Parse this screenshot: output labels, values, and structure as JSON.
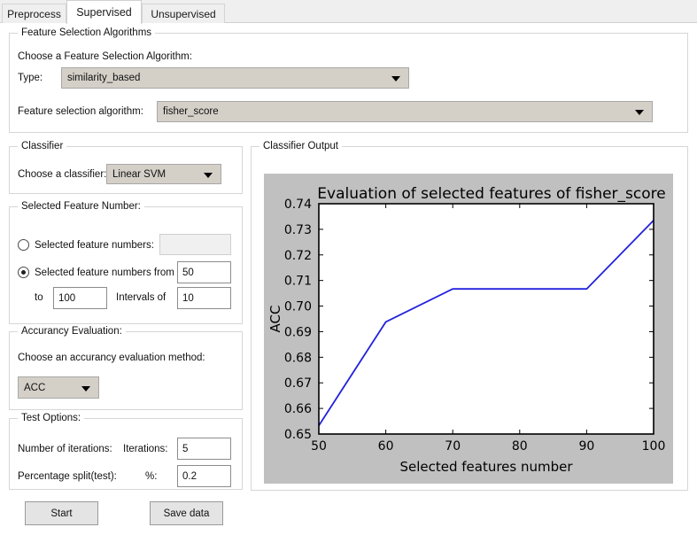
{
  "tabs": [
    {
      "label": "Preprocess",
      "active": false
    },
    {
      "label": "Supervised",
      "active": true
    },
    {
      "label": "Unsupervised",
      "active": false
    }
  ],
  "feature_selection": {
    "group_label": "Feature Selection Algorithms",
    "prompt": "Choose a Feature Selection Algorithm:",
    "type_label": "Type:",
    "type_value": "similarity_based",
    "algorithm_label": "Feature selection algorithm:",
    "algorithm_value": "fisher_score"
  },
  "classifier": {
    "group_label": "Classifier",
    "choose_label": "Choose a classifier:",
    "value": "Linear SVM"
  },
  "selected_feature_number": {
    "group_label": "Selected Feature Number:",
    "single_radio_label": "Selected feature numbers:",
    "single_value": "",
    "single_selected": false,
    "range_radio_label": "Selected feature numbers from",
    "range_selected": true,
    "from_value": "50",
    "to_label": "to",
    "to_value": "100",
    "intervals_label": "Intervals of",
    "intervals_value": "10"
  },
  "accuracy_evaluation": {
    "group_label": "Accurancy Evaluation:",
    "prompt": "Choose an accurancy evaluation method:",
    "value": "ACC"
  },
  "test_options": {
    "group_label": "Test Options:",
    "iterations_row_label": "Number of iterations:",
    "iterations_field_label": "Iterations:",
    "iterations_value": "5",
    "split_row_label": "Percentage split(test):",
    "split_field_label": "%:",
    "split_value": "0.2"
  },
  "actions": {
    "start_label": "Start",
    "save_label": "Save data"
  },
  "classifier_output": {
    "group_label": "Classifier Output"
  },
  "chart_data": {
    "type": "line",
    "title": "Evaluation of selected features of fisher_score",
    "xlabel": "Selected features number",
    "ylabel": "ACC",
    "x": [
      50,
      60,
      70,
      80,
      90,
      100
    ],
    "values": [
      0.6533,
      0.6938,
      0.7067,
      0.7067,
      0.7067,
      0.7335
    ],
    "series": [
      {
        "name": "ACC",
        "color": "#2222dd",
        "values": [
          0.6533,
          0.6938,
          0.7067,
          0.7067,
          0.7067,
          0.7335
        ]
      }
    ],
    "xlim": [
      50,
      100
    ],
    "ylim": [
      0.65,
      0.74
    ],
    "xticks": [
      50,
      60,
      70,
      80,
      90,
      100
    ],
    "yticks": [
      0.65,
      0.66,
      0.67,
      0.68,
      0.69,
      0.7,
      0.71,
      0.72,
      0.73,
      0.74
    ],
    "xticklabels": [
      "50",
      "60",
      "70",
      "80",
      "90",
      "100"
    ],
    "yticklabels": [
      "0.65",
      "0.66",
      "0.67",
      "0.68",
      "0.69",
      "0.70",
      "0.71",
      "0.72",
      "0.73",
      "0.74"
    ],
    "grid": false,
    "legend": false,
    "figure_background": "#c0c0c0",
    "plot_background": "#ffffff"
  }
}
